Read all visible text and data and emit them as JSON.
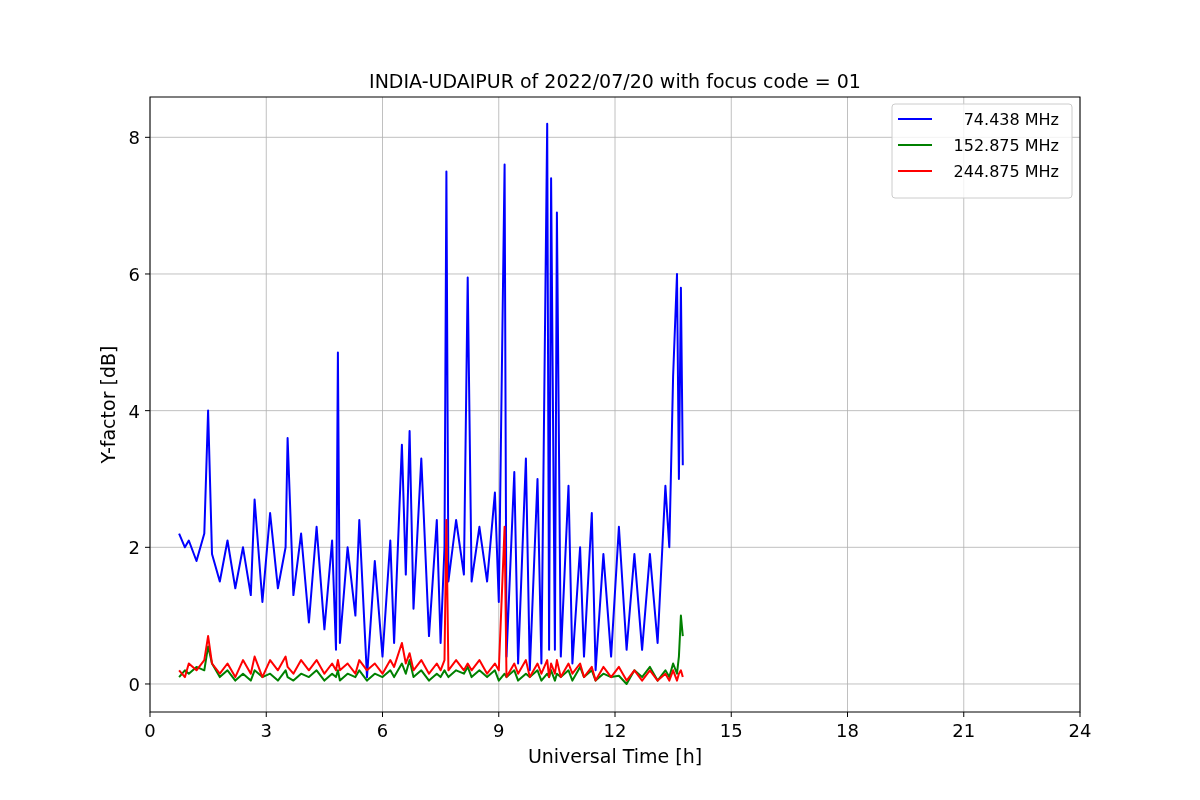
{
  "figure": {
    "chart_data": {
      "type": "line",
      "title": "INDIA-UDAIPUR of 2022/07/20 with focus code = 01",
      "xlabel": "Universal Time [h]",
      "ylabel": "Y-factor [dB]",
      "x": [
        0.75,
        0.9,
        1.0,
        1.2,
        1.4,
        1.5,
        1.6,
        1.8,
        2.0,
        2.2,
        2.4,
        2.6,
        2.7,
        2.9,
        3.1,
        3.3,
        3.5,
        3.55,
        3.7,
        3.9,
        4.1,
        4.3,
        4.5,
        4.7,
        4.8,
        4.85,
        4.9,
        5.1,
        5.3,
        5.4,
        5.6,
        5.8,
        6.0,
        6.2,
        6.3,
        6.5,
        6.6,
        6.7,
        6.8,
        7.0,
        7.2,
        7.4,
        7.5,
        7.6,
        7.65,
        7.7,
        7.9,
        8.1,
        8.2,
        8.3,
        8.5,
        8.7,
        8.9,
        9.0,
        9.15,
        9.2,
        9.4,
        9.5,
        9.7,
        9.8,
        10.0,
        10.1,
        10.25,
        10.3,
        10.35,
        10.45,
        10.5,
        10.6,
        10.8,
        10.9,
        11.1,
        11.2,
        11.4,
        11.5,
        11.7,
        11.9,
        12.1,
        12.3,
        12.5,
        12.7,
        12.9,
        13.1,
        13.3,
        13.4,
        13.5,
        13.6,
        13.65,
        13.7,
        13.75
      ],
      "series": [
        {
          "name": "74.438 MHz",
          "color": "#0000ff",
          "values": [
            2.2,
            2.0,
            2.1,
            1.8,
            2.2,
            4.0,
            1.9,
            1.5,
            2.1,
            1.4,
            2.0,
            1.3,
            2.7,
            1.2,
            2.5,
            1.4,
            2.0,
            3.6,
            1.3,
            2.2,
            0.9,
            2.3,
            0.8,
            2.1,
            0.5,
            4.85,
            0.6,
            2.0,
            1.0,
            2.4,
            0.1,
            1.8,
            0.4,
            2.1,
            0.6,
            3.5,
            1.6,
            3.7,
            1.1,
            3.3,
            0.7,
            2.4,
            0.6,
            2.0,
            7.5,
            1.5,
            2.4,
            1.6,
            5.95,
            1.5,
            2.3,
            1.5,
            2.8,
            1.2,
            7.6,
            0.4,
            3.1,
            0.3,
            3.3,
            0.2,
            3.0,
            0.3,
            8.2,
            0.5,
            7.4,
            0.5,
            6.9,
            0.4,
            2.9,
            0.3,
            2.0,
            0.4,
            2.5,
            0.2,
            1.9,
            0.4,
            2.3,
            0.5,
            1.9,
            0.5,
            1.9,
            0.6,
            2.9,
            2.0,
            4.5,
            6.0,
            3.0,
            5.8,
            3.2
          ]
        },
        {
          "name": "152.875 MHz",
          "color": "#008000",
          "values": [
            0.1,
            0.2,
            0.15,
            0.25,
            0.2,
            0.55,
            0.3,
            0.1,
            0.2,
            0.05,
            0.15,
            0.05,
            0.2,
            0.1,
            0.15,
            0.05,
            0.2,
            0.1,
            0.05,
            0.15,
            0.1,
            0.2,
            0.05,
            0.15,
            0.1,
            0.2,
            0.05,
            0.15,
            0.1,
            0.2,
            0.05,
            0.15,
            0.1,
            0.2,
            0.1,
            0.3,
            0.15,
            0.35,
            0.1,
            0.2,
            0.05,
            0.15,
            0.1,
            0.2,
            0.15,
            0.1,
            0.2,
            0.15,
            0.25,
            0.1,
            0.2,
            0.1,
            0.2,
            0.05,
            0.15,
            0.1,
            0.2,
            0.05,
            0.15,
            0.1,
            0.2,
            0.05,
            0.15,
            0.1,
            0.2,
            0.05,
            0.15,
            0.1,
            0.2,
            0.05,
            0.25,
            0.1,
            0.2,
            0.05,
            0.15,
            0.1,
            0.12,
            0.0,
            0.2,
            0.1,
            0.25,
            0.05,
            0.2,
            0.1,
            0.3,
            0.15,
            0.4,
            1.0,
            0.7
          ]
        },
        {
          "name": "244.875 MHz",
          "color": "#ff0000",
          "values": [
            0.2,
            0.1,
            0.3,
            0.2,
            0.35,
            0.7,
            0.3,
            0.15,
            0.3,
            0.1,
            0.35,
            0.15,
            0.4,
            0.1,
            0.35,
            0.2,
            0.4,
            0.25,
            0.15,
            0.35,
            0.2,
            0.35,
            0.15,
            0.3,
            0.2,
            0.35,
            0.2,
            0.3,
            0.15,
            0.35,
            0.2,
            0.3,
            0.15,
            0.35,
            0.25,
            0.6,
            0.3,
            0.45,
            0.2,
            0.35,
            0.15,
            0.3,
            0.2,
            0.35,
            2.4,
            0.2,
            0.35,
            0.2,
            0.3,
            0.2,
            0.35,
            0.15,
            0.3,
            0.2,
            2.3,
            0.1,
            0.3,
            0.15,
            0.35,
            0.1,
            0.3,
            0.15,
            0.35,
            0.1,
            0.3,
            0.15,
            0.35,
            0.1,
            0.3,
            0.15,
            0.3,
            0.1,
            0.25,
            0.05,
            0.25,
            0.1,
            0.25,
            0.05,
            0.2,
            0.05,
            0.2,
            0.05,
            0.15,
            0.05,
            0.2,
            0.05,
            0.15,
            0.2,
            0.1
          ]
        }
      ],
      "grid": true,
      "legend": true,
      "xlim": [
        0,
        24
      ],
      "ylim": [
        -0.41,
        8.59
      ],
      "xticks": [
        0,
        3,
        6,
        9,
        12,
        15,
        18,
        21,
        24
      ],
      "yticks": [
        0,
        2,
        4,
        6,
        8
      ]
    }
  }
}
